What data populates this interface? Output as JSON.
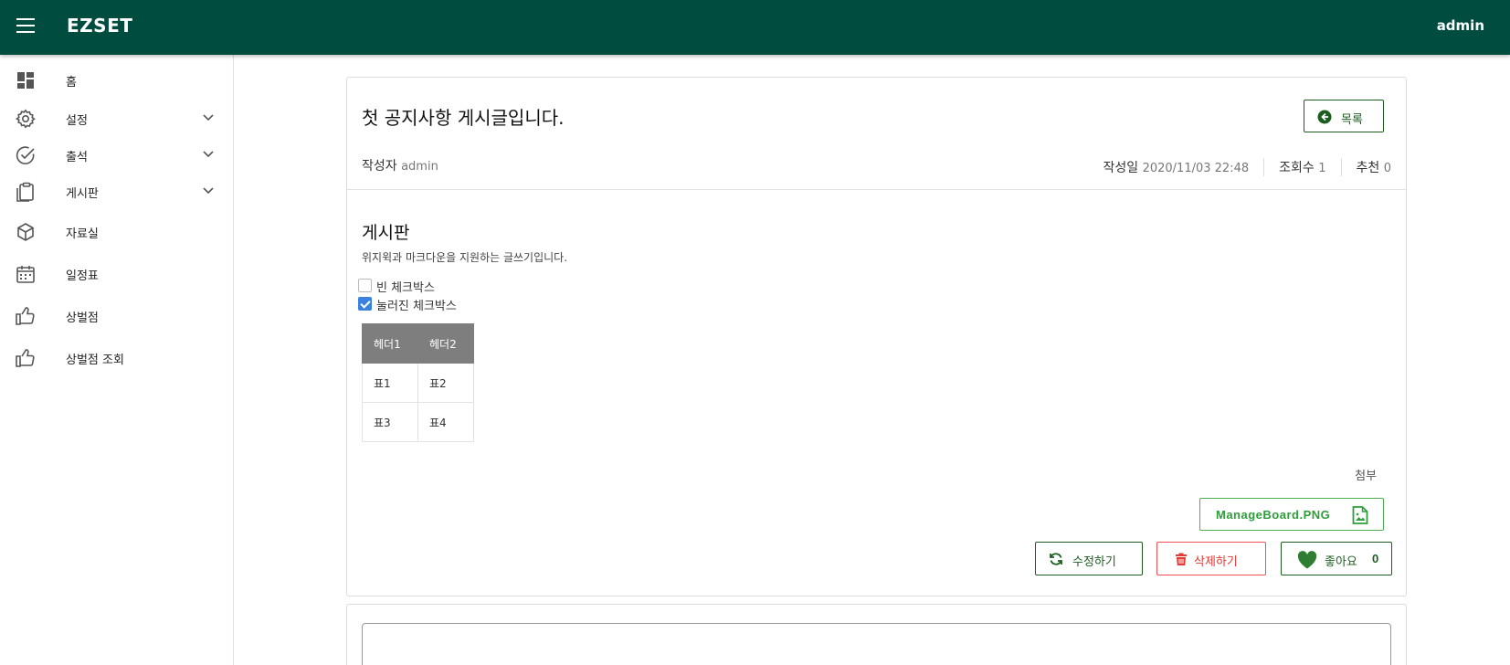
{
  "topbar": {
    "brand": "EZSET",
    "user": "admin",
    "bg_color": "#004d40",
    "menu_icon": "hamburger-icon"
  },
  "sidebar": {
    "items": [
      {
        "label": "홈",
        "icon": "dashboard-icon",
        "expandable": false
      },
      {
        "label": "설정",
        "icon": "gear-icon",
        "expandable": true
      },
      {
        "label": "출석",
        "icon": "check-circle-icon",
        "expandable": true
      },
      {
        "label": "게시판",
        "icon": "clipboard-icon",
        "expandable": true
      },
      {
        "label": "자료실",
        "icon": "cube-icon",
        "expandable": false
      },
      {
        "label": "일정표",
        "icon": "calendar-icon",
        "expandable": false
      },
      {
        "label": "상벌점",
        "icon": "thumbs-up-icon",
        "expandable": false
      },
      {
        "label": "상벌점 조회",
        "icon": "thumbs-up-icon",
        "expandable": false
      }
    ]
  },
  "post": {
    "title": "첫 공지사항 게시글입니다.",
    "list_button": "목록",
    "author_label": "작성자",
    "author": "admin",
    "date_label": "작성일",
    "date": "2020/11/03 22:48",
    "views_label": "조회수",
    "views": "1",
    "recommend_label": "추천",
    "recommend": "0"
  },
  "content": {
    "heading": "게시판",
    "description": "위지윅과 마크다운을 지원하는 글쓰기입니다.",
    "checkboxes": [
      {
        "label": "빈 체크박스",
        "checked": false
      },
      {
        "label": "눌러진 체크박스",
        "checked": true
      }
    ],
    "table": {
      "headers": [
        "헤더1",
        "헤더2"
      ],
      "rows": [
        [
          "표1",
          "표2"
        ],
        [
          "표3",
          "표4"
        ]
      ]
    }
  },
  "attachment": {
    "label": "첨부",
    "file_name": "ManageBoard.PNG",
    "file_icon": "image-file-icon"
  },
  "actions": {
    "edit_label": "수정하기",
    "delete_label": "삭제하기",
    "like_label": "좋아요",
    "like_count": "0"
  },
  "colors": {
    "accent": "#1b5e20",
    "danger": "#e53935",
    "file": "#4caf50",
    "header_bg": "#004d40"
  }
}
